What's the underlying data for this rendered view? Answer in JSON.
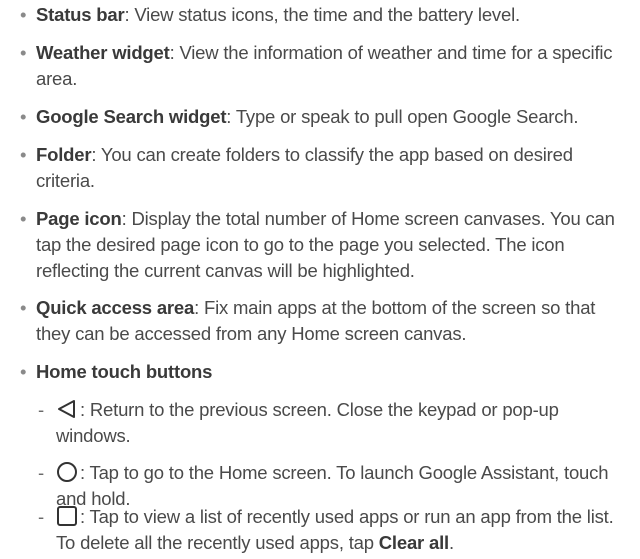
{
  "bullet_char": "•",
  "dash_char": "-",
  "items": [
    {
      "label": "Status bar",
      "desc": ": View status icons, the time and the battery level."
    },
    {
      "label": "Weather widget",
      "desc": ": View the information of weather and time for a specific area."
    },
    {
      "label": "Google Search widget",
      "desc": ": Type or speak to pull open Google Search."
    },
    {
      "label": "Folder",
      "desc": ": You can create folders to classify the app based on desired criteria."
    },
    {
      "label": "Page icon",
      "desc": ": Display the total number of Home screen canvases. You can tap the desired page icon to go to the page you selected. The icon reflecting the current canvas will be highlighted."
    },
    {
      "label": "Quick access area",
      "desc": ": Fix main apps at the bottom of the screen so that they can be accessed from any Home screen canvas."
    },
    {
      "label": "Home touch buttons",
      "desc": ""
    }
  ],
  "home_buttons": [
    {
      "icon": "back-icon",
      "desc": ": Return to the previous screen. Close the keypad or pop-up windows."
    },
    {
      "icon": "home-icon",
      "desc": ": Tap to go to the Home screen. To launch Google Assistant, touch and hold."
    },
    {
      "icon": "recents-icon",
      "desc_before": ": Tap to view a list of recently used apps or run an app from the list. To delete all the recently used apps, tap ",
      "bold": "Clear all",
      "desc_after": "."
    }
  ]
}
